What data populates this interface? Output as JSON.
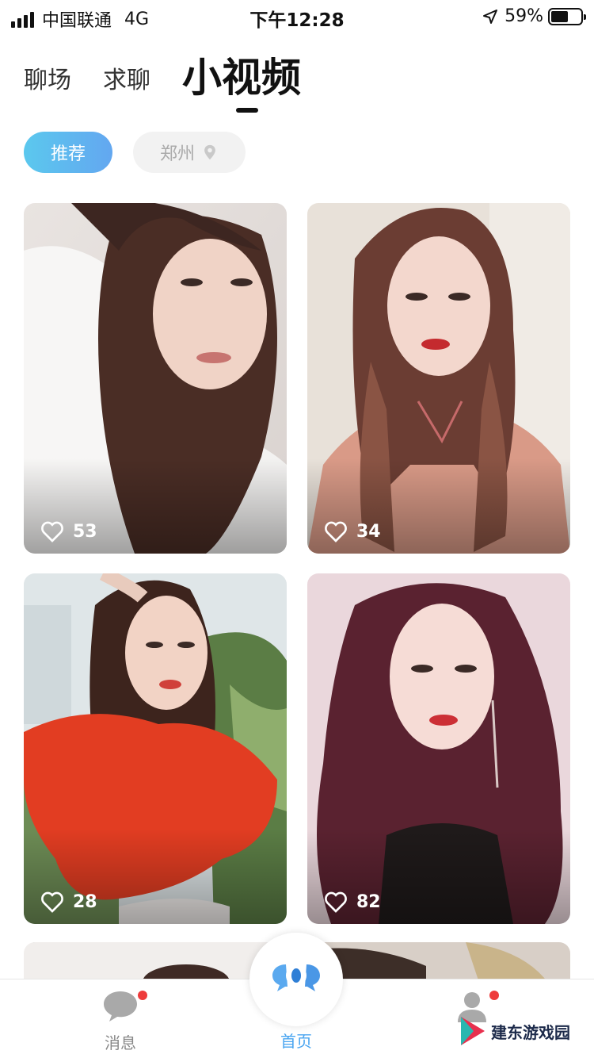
{
  "status_bar": {
    "carrier": "中国联通",
    "network": "4G",
    "time": "下午12:28",
    "battery": "59%",
    "battery_level": 0.59
  },
  "tabs": [
    {
      "label": "聊场",
      "active": false
    },
    {
      "label": "求聊",
      "active": false
    },
    {
      "label": "小视频",
      "active": true
    }
  ],
  "filters": {
    "recommend": "推荐",
    "city": "郑州"
  },
  "videos": [
    {
      "likes": "53"
    },
    {
      "likes": "34"
    },
    {
      "likes": "28"
    },
    {
      "likes": "82"
    }
  ],
  "bottom_nav": {
    "messages": "消息",
    "home": "首页"
  },
  "watermark": "建东游戏园",
  "colors": {
    "accent": "#4aa5f0",
    "chip_gradient_start": "#5bc8ee",
    "chip_gradient_end": "#63a7f0",
    "notification_dot": "#ee3b3b"
  }
}
